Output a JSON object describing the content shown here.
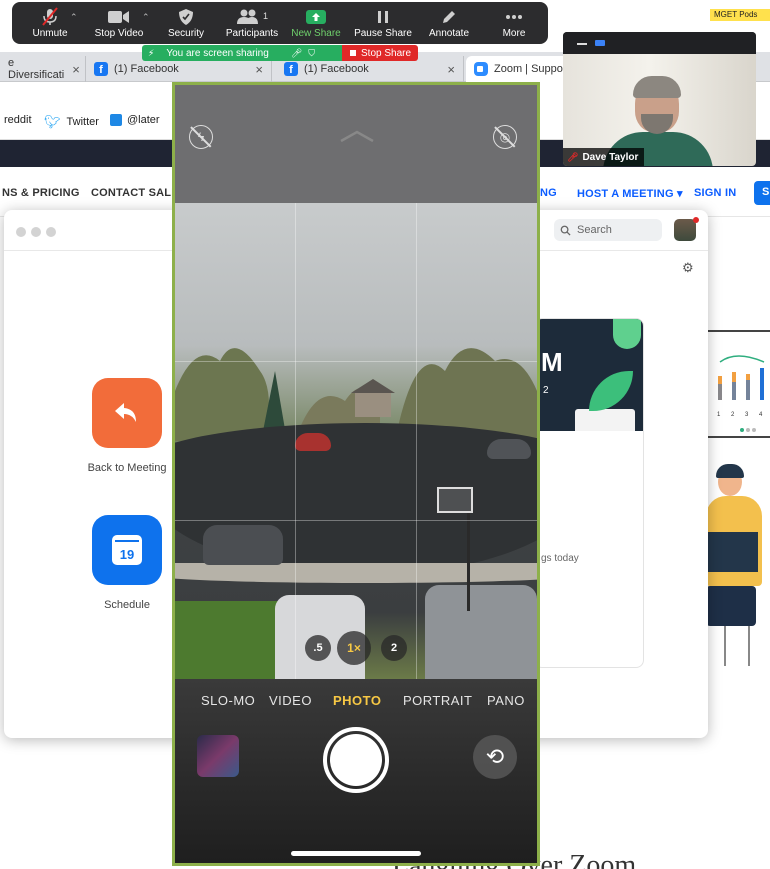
{
  "toolbar": {
    "items": [
      {
        "label": "Unmute",
        "icon": "mic-muted-icon"
      },
      {
        "label": "Stop Video",
        "icon": "video-camera-icon"
      },
      {
        "label": "Security",
        "icon": "shield-icon"
      },
      {
        "label": "Participants",
        "icon": "participants-icon",
        "count": "1"
      },
      {
        "label": "New Share",
        "icon": "share-up-icon"
      },
      {
        "label": "Pause Share",
        "icon": "pause-icon"
      },
      {
        "label": "Annotate",
        "icon": "pencil-icon"
      },
      {
        "label": "More",
        "icon": "ellipsis-icon"
      }
    ],
    "sharing_status": "You are screen sharing",
    "stop_share": "Stop Share",
    "accent_green": "#6fd06c",
    "stop_red": "#e02828"
  },
  "corner_label": "MGET Pods",
  "video": {
    "participant_name": "Dave Taylor"
  },
  "browser": {
    "tabs": [
      {
        "title": "e Diversificati"
      },
      {
        "title": "(1) Facebook"
      },
      {
        "title": "(1) Facebook"
      },
      {
        "title": "Zoom | Support"
      }
    ],
    "bookmarks": [
      "reddit",
      "Twitter",
      "@later"
    ]
  },
  "zoom_site_nav": {
    "left_links": [
      "NS & PRICING",
      "CONTACT SALES"
    ],
    "right_links": [
      "NG",
      "HOST A MEETING",
      "SIGN IN"
    ],
    "button_fragment": "S"
  },
  "zoom_client": {
    "search_placeholder": "Search",
    "back_to_meeting": "Back to Meeting",
    "schedule": "Schedule",
    "calendar_day": "19",
    "card_letter": "M",
    "card_sub": "2",
    "meetings_text": "gs today"
  },
  "camera": {
    "modes": [
      "SLO-MO",
      "VIDEO",
      "PHOTO",
      "PORTRAIT",
      "PANO"
    ],
    "active_mode": "PHOTO",
    "zoom_levels": [
      ".5",
      "1×",
      "2"
    ],
    "active_mode_color": "#f7c844"
  },
  "bottom_text": "Laughing Over Zoom"
}
